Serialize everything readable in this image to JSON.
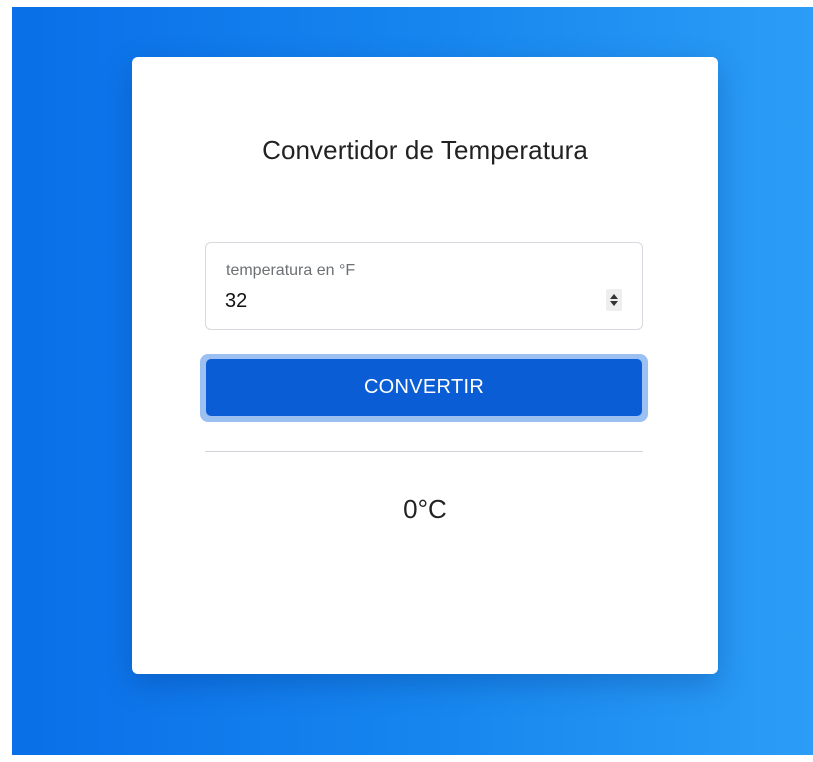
{
  "converter": {
    "title": "Convertidor de Temperatura",
    "input": {
      "label": "temperatura en °F",
      "value": "32"
    },
    "button_label": "CONVERTIR",
    "result": "0°C"
  },
  "colors": {
    "background_gradient_start": "#0a6fe8",
    "background_gradient_end": "#2c9df6",
    "button": "#0b5dd6",
    "button_focus_ring": "#9cc0f2"
  }
}
